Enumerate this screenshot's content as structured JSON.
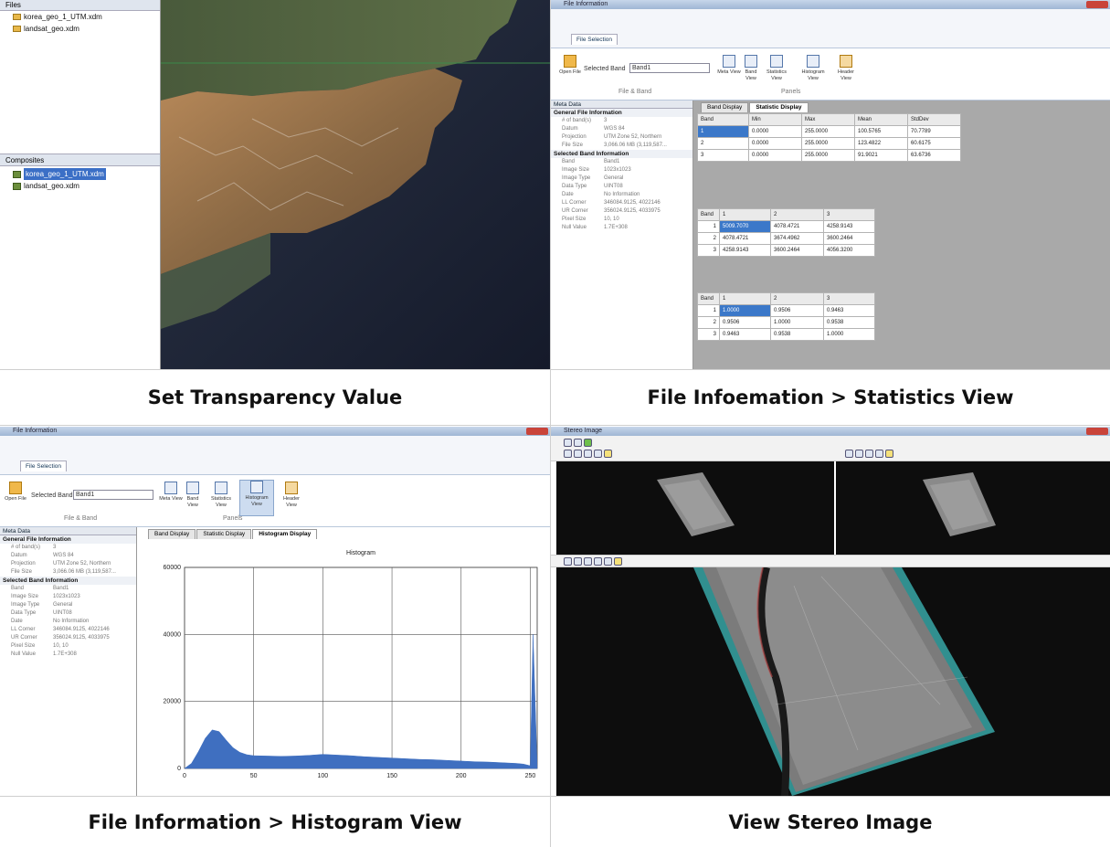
{
  "captions": {
    "p1": "Set Transparency Value",
    "p2": "File Infoemation > Statistics View",
    "p3": "File Information > Histogram View",
    "p4": "View Stereo Image"
  },
  "panel1": {
    "files_header": "Files",
    "files": [
      "korea_geo_1_UTM.xdm",
      "landsat_geo.xdm"
    ],
    "composites_header": "Composites",
    "composites": [
      "korea_geo_1_UTM.xdm",
      "landsat_geo.xdm"
    ]
  },
  "fileinfo": {
    "window_title": "File Information",
    "ribbon_tab": "File Selection",
    "open_file": "Open File",
    "selected_band_label": "Selected Band",
    "selected_band_value": "Band1",
    "group_file_band": "File & Band",
    "group_panels": "Panels",
    "panel_buttons": [
      "Meta View",
      "Band View",
      "Statistics View",
      "Histogram View",
      "Header View"
    ],
    "meta_header": "Meta Data",
    "general_section": "General File Information",
    "general_rows": [
      [
        "# of band(s)",
        "3"
      ],
      [
        "Datum",
        "WGS 84"
      ],
      [
        "Projection",
        "UTM Zone 52, Northern"
      ],
      [
        "File Size",
        "3,066.06 MB (3,119,587..."
      ]
    ],
    "band_section": "Selected Band Information",
    "band_rows": [
      [
        "Band",
        "Band1"
      ],
      [
        "Image Size",
        "1023x1023"
      ],
      [
        "Image Type",
        "General"
      ],
      [
        "Data Type",
        "UINT08"
      ],
      [
        "Date",
        "No Information"
      ],
      [
        "LL Corner",
        "346084.9125, 4022146"
      ],
      [
        "UR Corner",
        "356024.9125, 4033975"
      ],
      [
        "Pixel Size",
        "10, 10"
      ],
      [
        "Null Value",
        "1.7E+308"
      ]
    ],
    "tabs_stat": [
      "Band Display",
      "Statistic Display"
    ],
    "tabs_hist": [
      "Band Display",
      "Statistic Display",
      "Histogram Display"
    ],
    "stats_header": [
      "Band",
      "Min",
      "Max",
      "Mean",
      "StdDev"
    ],
    "stats_rows": [
      [
        "1",
        "0.0000",
        "255.0000",
        "100.5765",
        "70.7789"
      ],
      [
        "2",
        "0.0000",
        "255.0000",
        "123.4822",
        "60.6175"
      ],
      [
        "3",
        "0.0000",
        "255.0000",
        "91.9021",
        "63.6736"
      ]
    ],
    "cov_header": [
      "Band",
      "1",
      "2",
      "3"
    ],
    "cov_rows": [
      [
        "1",
        "5009.7070",
        "4078.4721",
        "4258.9143"
      ],
      [
        "2",
        "4078.4721",
        "3674.4962",
        "3600.2464"
      ],
      [
        "3",
        "4258.9143",
        "3600.2464",
        "4056.3200"
      ]
    ],
    "corr_header": [
      "Band",
      "1",
      "2",
      "3"
    ],
    "corr_rows": [
      [
        "1",
        "1.0000",
        "0.9506",
        "0.9463"
      ],
      [
        "2",
        "0.9506",
        "1.0000",
        "0.9538"
      ],
      [
        "3",
        "0.9463",
        "0.9538",
        "1.0000"
      ]
    ]
  },
  "chart_data": {
    "type": "area",
    "title": "Histogram",
    "xlabel": "",
    "ylabel": "",
    "xlim": [
      0,
      255
    ],
    "ylim": [
      0,
      60000
    ],
    "x_ticks": [
      0,
      50,
      100,
      150,
      200,
      250
    ],
    "y_ticks": [
      0,
      20000,
      40000,
      60000
    ],
    "grid": true,
    "series": [
      {
        "color": "#3f6fc0",
        "x": [
          0,
          5,
          10,
          15,
          20,
          25,
          30,
          35,
          40,
          45,
          50,
          60,
          70,
          80,
          90,
          100,
          110,
          120,
          130,
          140,
          150,
          160,
          170,
          180,
          190,
          200,
          210,
          220,
          230,
          240,
          245,
          250,
          252,
          255
        ],
        "y": [
          0,
          1500,
          5000,
          9000,
          11500,
          11000,
          8500,
          6200,
          4800,
          4100,
          3800,
          3700,
          3600,
          3700,
          3900,
          4200,
          4000,
          3800,
          3500,
          3300,
          3100,
          2900,
          2700,
          2600,
          2400,
          2200,
          2000,
          1900,
          1700,
          1500,
          1300,
          800,
          40000,
          0
        ]
      }
    ]
  },
  "stereo": {
    "window_title": "Stereo Image"
  }
}
